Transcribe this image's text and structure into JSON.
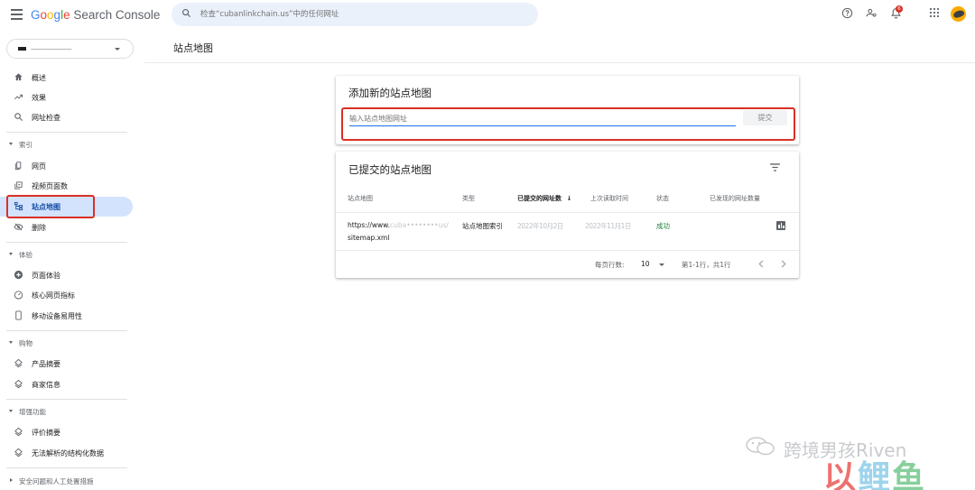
{
  "header": {
    "brand_letters": [
      "G",
      "o",
      "o",
      "g",
      "l",
      "e"
    ],
    "product": "Search Console",
    "search_placeholder": "检查“cubanlinkchain.us”中的任何网址",
    "notification_count": "6"
  },
  "sidebar": {
    "property_value": "–––––––––––––––",
    "top_items": [
      {
        "label": "概述",
        "icon": "home-icon"
      },
      {
        "label": "效果",
        "icon": "trending-up-icon"
      },
      {
        "label": "网址检查",
        "icon": "search-icon"
      }
    ],
    "sections": [
      {
        "title": "索引",
        "items": [
          {
            "label": "网页",
            "icon": "page-icon"
          },
          {
            "label": "视频页面数",
            "icon": "video-page-icon"
          },
          {
            "label": "站点地图",
            "icon": "sitemap-icon",
            "active": true
          },
          {
            "label": "删除",
            "icon": "remove-eye-icon"
          }
        ]
      },
      {
        "title": "体验",
        "items": [
          {
            "label": "页面体验",
            "icon": "plus-circle-icon"
          },
          {
            "label": "核心网页指标",
            "icon": "gauge-icon"
          },
          {
            "label": "移动设备易用性",
            "icon": "phone-icon"
          }
        ]
      },
      {
        "title": "购物",
        "items": [
          {
            "label": "产品摘要",
            "icon": "diamond-icon"
          },
          {
            "label": "商家信息",
            "icon": "diamond-icon"
          }
        ]
      },
      {
        "title": "增强功能",
        "items": [
          {
            "label": "评价摘要",
            "icon": "diamond-icon"
          },
          {
            "label": "无法解析的结构化数据",
            "icon": "diamond-icon"
          }
        ]
      },
      {
        "title": "安全问题和人工处置措施",
        "collapsed": true,
        "items": []
      }
    ]
  },
  "main": {
    "page_title": "站点地图",
    "add_card": {
      "title": "添加新的站点地图",
      "input_placeholder": "输入站点地图网址",
      "submit_label": "提交"
    },
    "submitted_card": {
      "title": "已提交的站点地图",
      "columns": [
        "站点地图",
        "类型",
        "已提交的网址数",
        "上次读取时间",
        "状态",
        "已发现的网址数量"
      ],
      "sort_arrow": "↓",
      "rows": [
        {
          "sitemap_line1": "https://www.",
          "sitemap_line1_blur": "cuba••••••••us/",
          "sitemap_line2": "sitemap.xml",
          "type": "站点地图索引",
          "submitted": "2022年10月2日",
          "last_read": "2022年11月1日",
          "status": "成功"
        }
      ],
      "footer": {
        "rows_per_page_label": "每页行数:",
        "rows_per_page": "10",
        "range": "第1-1行，共1行"
      }
    }
  },
  "watermark": {
    "text": "跨境男孩Riven",
    "brand": [
      "以",
      "鲤",
      "鱼"
    ]
  }
}
